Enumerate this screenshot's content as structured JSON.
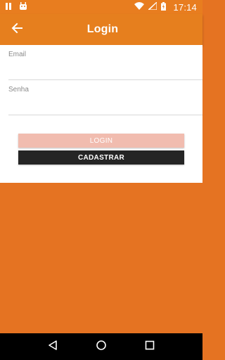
{
  "status_bar": {
    "time": "17:14"
  },
  "app_bar": {
    "title": "Login"
  },
  "form": {
    "email": {
      "label": "Email",
      "value": ""
    },
    "senha": {
      "label": "Senha",
      "value": ""
    }
  },
  "buttons": {
    "login_label": "LOGIN",
    "cadastrar_label": "CADASTRAR"
  },
  "colors": {
    "accent_orange": "#e67f1e",
    "background_orange": "#e57322",
    "login_button_disabled": "#f1bcaf",
    "cadastrar_button": "#252525"
  },
  "icons": {
    "status_left": [
      "pause-notification-icon",
      "android-notification-icon"
    ],
    "status_right": [
      "wifi-icon",
      "signal-icon",
      "battery-icon"
    ],
    "app_bar": "back-arrow-icon",
    "nav": [
      "nav-back-icon",
      "nav-home-icon",
      "nav-recents-icon"
    ]
  }
}
